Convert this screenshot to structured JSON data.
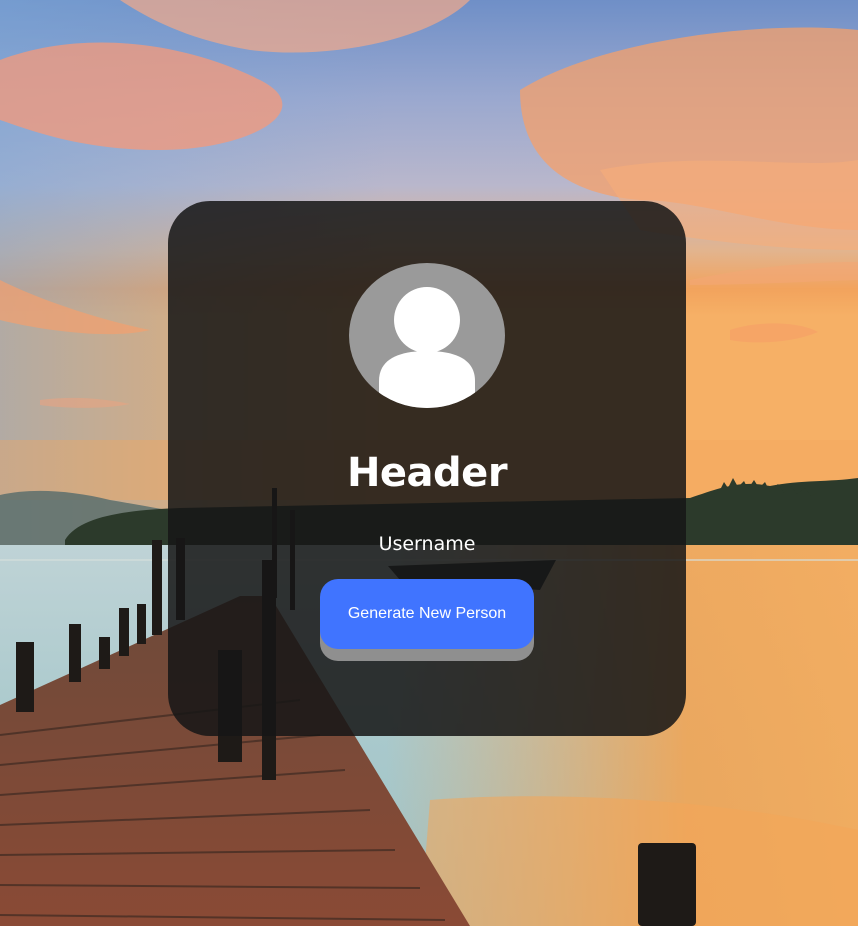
{
  "card": {
    "header": "Header",
    "username": "Username",
    "generate_button_label": "Generate New Person"
  },
  "icons": {
    "avatar": "user-placeholder-icon"
  },
  "colors": {
    "card_background": "#161616",
    "button_background": "#4074ff",
    "button_shadow": "#8f8f8f",
    "avatar_background": "#9a9a9a"
  }
}
